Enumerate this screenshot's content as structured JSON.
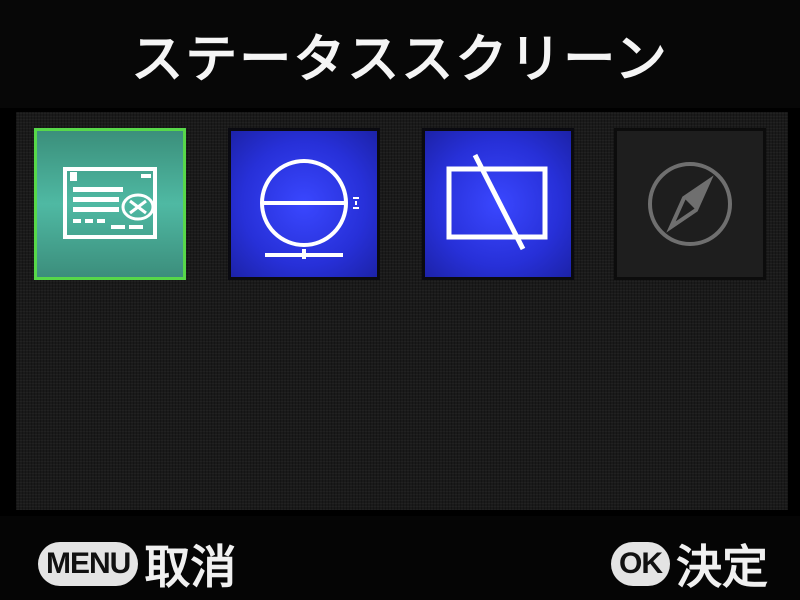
{
  "header": {
    "title": "ステータススクリーン"
  },
  "options": [
    {
      "icon": "status-screen-icon",
      "selected": true
    },
    {
      "icon": "electronic-level-icon",
      "selected": false
    },
    {
      "icon": "display-off-icon",
      "selected": false
    },
    {
      "icon": "compass-icon",
      "selected": false,
      "disabled": true
    }
  ],
  "footer": {
    "cancel_key": "MENU",
    "cancel_label": "取消",
    "ok_key": "OK",
    "ok_label": "決定"
  },
  "colors": {
    "selected_border": "#57d84a",
    "selected_fill": "#4fb9a3",
    "option_fill": "#2730d8",
    "disabled_fill": "#1e1e1e"
  }
}
